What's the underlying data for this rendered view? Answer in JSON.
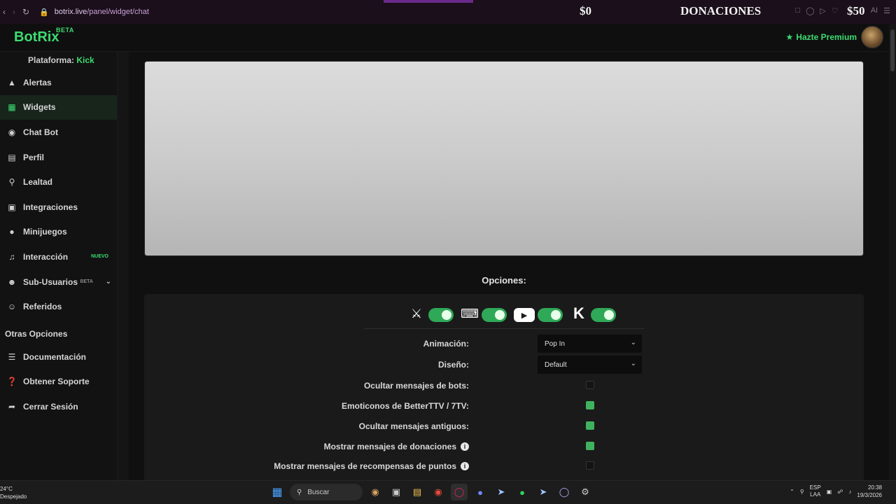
{
  "browser": {
    "url_host": "botrix.live",
    "url_path": "/panel/widget/chat",
    "overlay_left_amount": "$0",
    "overlay_title": "DONACIONES",
    "overlay_right_amount": "$50",
    "overlay_right_suffix": "AI",
    "tab_accent": "#6a2a8a"
  },
  "header": {
    "logo": "BotRix",
    "logo_badge": "BETA",
    "premium_label": "Hazte Premium",
    "accent": "#3ddc72"
  },
  "sidebar": {
    "platform_label": "Plataforma:",
    "platform_value": "Kick",
    "items": [
      {
        "label": "Alertas",
        "icon": "warning-icon"
      },
      {
        "label": "Widgets",
        "icon": "grid-icon",
        "active": true
      },
      {
        "label": "Chat Bot",
        "icon": "robot-icon"
      },
      {
        "label": "Perfil",
        "icon": "id-card-icon"
      },
      {
        "label": "Lealtad",
        "icon": "trophy-icon"
      },
      {
        "label": "Integraciones",
        "icon": "integration-icon"
      },
      {
        "label": "Minijuegos",
        "icon": "gamepad-icon"
      },
      {
        "label": "Interacción",
        "icon": "music-icon",
        "badge": "NUEVO"
      },
      {
        "label": "Sub-Usuarios",
        "icon": "users-icon",
        "badge": "BETA"
      },
      {
        "label": "Referidos",
        "icon": "people-icon"
      }
    ],
    "other_title": "Otras Opciones",
    "other_items": [
      {
        "label": "Documentación",
        "icon": "book-icon"
      },
      {
        "label": "Obtener Soporte",
        "icon": "help-icon"
      },
      {
        "label": "Cerrar Sesión",
        "icon": "logout-icon"
      }
    ]
  },
  "main": {
    "options_title": "Opciones:",
    "platforms": [
      {
        "name": "kick-alt",
        "icon": "mascot-icon",
        "enabled": true
      },
      {
        "name": "twitch",
        "icon": "twitch-icon",
        "enabled": true
      },
      {
        "name": "youtube",
        "icon": "youtube-icon",
        "enabled": true
      },
      {
        "name": "kick",
        "icon": "kick-icon",
        "enabled": true
      }
    ],
    "animation_label": "Animación:",
    "animation_value": "Pop In",
    "design_label": "Diseño:",
    "design_value": "Default",
    "checks": [
      {
        "label": "Ocultar mensajes de bots:",
        "checked": false,
        "info": false
      },
      {
        "label": "Emoticonos de BetterTTV / 7TV:",
        "checked": true,
        "info": false
      },
      {
        "label": "Ocultar mensajes antiguos:",
        "checked": true,
        "info": false
      },
      {
        "label": "Mostrar mensajes de donaciones",
        "checked": true,
        "info": true
      },
      {
        "label": "Mostrar mensajes de recompensas de puntos",
        "checked": false,
        "info": true
      }
    ]
  },
  "taskbar": {
    "temp": "24°C",
    "weather": "Despejado",
    "search": "Buscar",
    "lang_top": "ESP",
    "lang_bottom": "LAA",
    "time": "20:38",
    "date": "19/3/2026"
  }
}
